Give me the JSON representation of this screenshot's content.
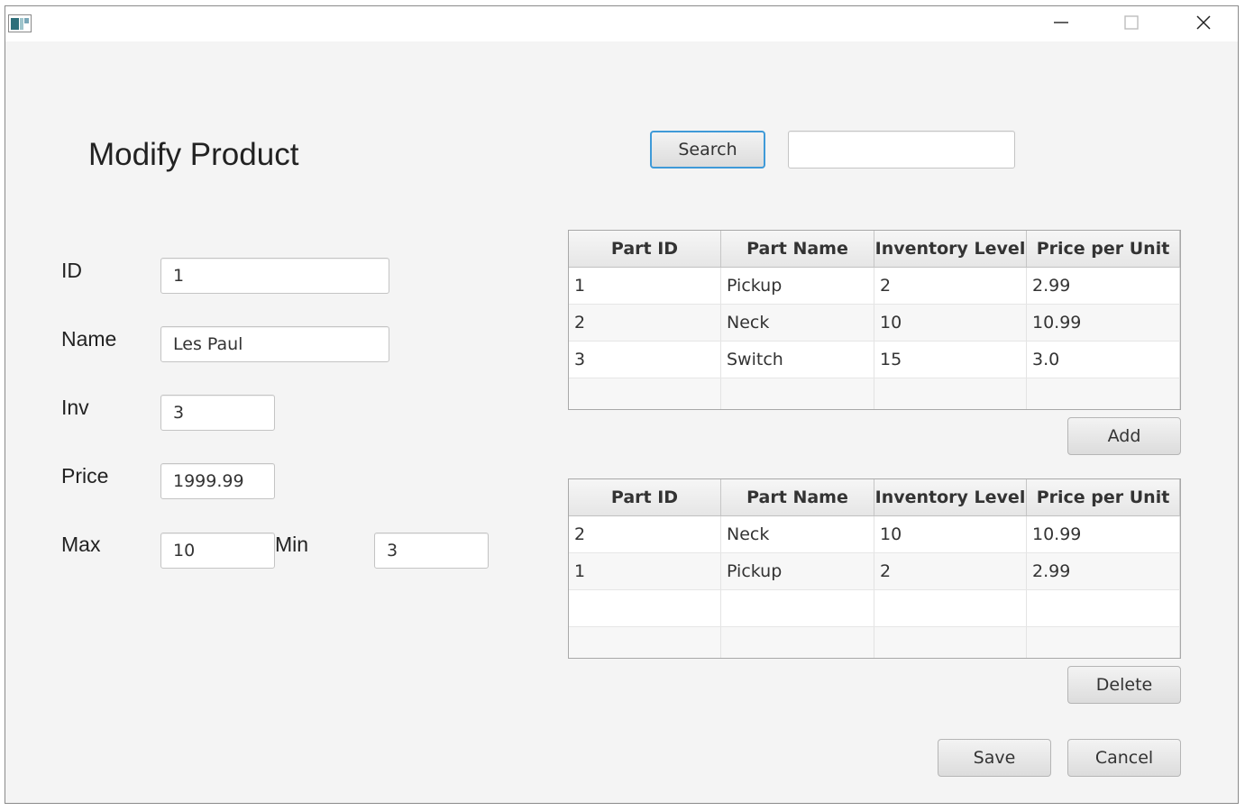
{
  "window": {
    "minimize_icon": "minimize-icon",
    "maximize_icon": "maximize-icon",
    "close_icon": "close-icon"
  },
  "form": {
    "title": "Modify Product",
    "id_label": "ID",
    "id_value": "1",
    "name_label": "Name",
    "name_value": "Les Paul",
    "inv_label": "Inv",
    "inv_value": "3",
    "price_label": "Price",
    "price_value": "1999.99",
    "max_label": "Max",
    "max_value": "10",
    "min_label": "Min",
    "min_value": "3"
  },
  "search": {
    "button_label": "Search",
    "value": ""
  },
  "parts_table": {
    "columns": [
      "Part ID",
      "Part Name",
      "Inventory Level",
      "Price per Unit"
    ],
    "rows": [
      [
        "1",
        "Pickup",
        "2",
        "2.99"
      ],
      [
        "2",
        "Neck",
        "10",
        "10.99"
      ],
      [
        "3",
        "Switch",
        "15",
        "3.0"
      ]
    ]
  },
  "add_button_label": "Add",
  "associated_table": {
    "columns": [
      "Part ID",
      "Part Name",
      "Inventory Level",
      "Price per Unit"
    ],
    "rows": [
      [
        "2",
        "Neck",
        "10",
        "10.99"
      ],
      [
        "1",
        "Pickup",
        "2",
        "2.99"
      ]
    ]
  },
  "delete_button_label": "Delete",
  "save_button_label": "Save",
  "cancel_button_label": "Cancel",
  "colors": {
    "focus": "#3f9ad8",
    "background": "#f4f4f4"
  }
}
